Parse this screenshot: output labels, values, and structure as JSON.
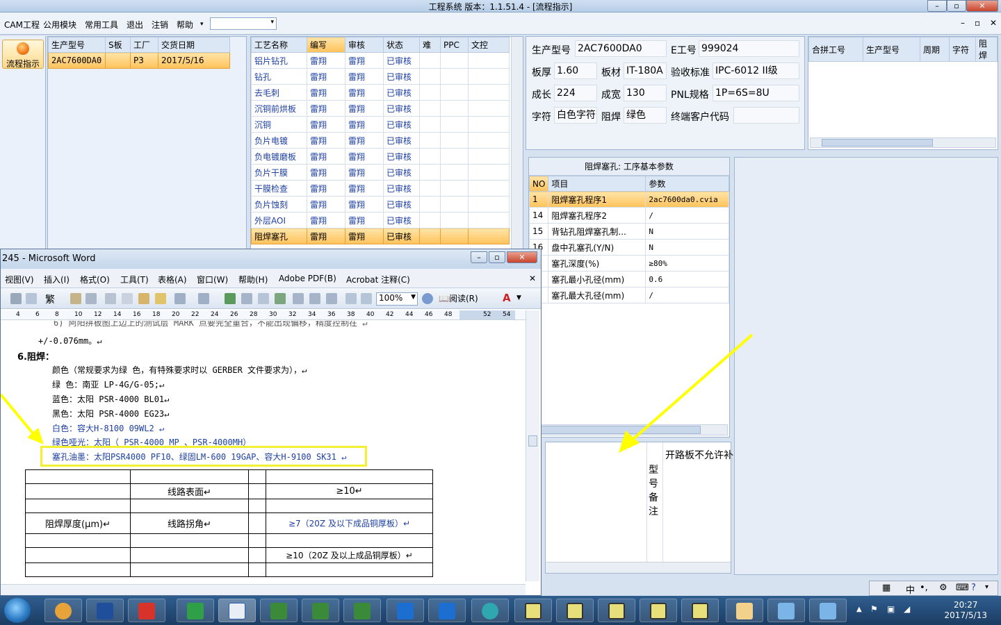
{
  "window": {
    "title": "工程系统 版本：1.1.51.4 - [流程指示]"
  },
  "menu": {
    "items": [
      "CAM工程",
      "公用模块",
      "常用工具",
      "退出",
      "注销",
      "帮助"
    ]
  },
  "nav": {
    "flow_button": "流程指示"
  },
  "orders": {
    "headers": [
      "生产型号",
      "S板",
      "工厂",
      "交货日期"
    ],
    "rows": [
      [
        "2AC7600DA0",
        "",
        "P3",
        "2017/5/16"
      ]
    ]
  },
  "process": {
    "headers": [
      "工艺名称",
      "编写",
      "审核",
      "状态",
      "难",
      "PPC",
      "文控"
    ],
    "rows": [
      [
        "铝片钻孔",
        "雷翔",
        "雷翔",
        "已审核"
      ],
      [
        "钻孔",
        "雷翔",
        "雷翔",
        "已审核"
      ],
      [
        "去毛刺",
        "雷翔",
        "雷翔",
        "已审核"
      ],
      [
        "沉铜前烘板",
        "雷翔",
        "雷翔",
        "已审核"
      ],
      [
        "沉铜",
        "雷翔",
        "雷翔",
        "已审核"
      ],
      [
        "负片电镀",
        "雷翔",
        "雷翔",
        "已审核"
      ],
      [
        "负电镀磨板",
        "雷翔",
        "雷翔",
        "已审核"
      ],
      [
        "负片干膜",
        "雷翔",
        "雷翔",
        "已审核"
      ],
      [
        "干膜检查",
        "雷翔",
        "雷翔",
        "已审核"
      ],
      [
        "负片蚀刻",
        "雷翔",
        "雷翔",
        "已审核"
      ],
      [
        "外层AOI",
        "雷翔",
        "雷翔",
        "已审核"
      ],
      [
        "阻焊塞孔",
        "雷翔",
        "雷翔",
        "已审核"
      ]
    ]
  },
  "info": {
    "model_label": "生产型号",
    "model": "2AC7600DA0",
    "eno_label": "E工号",
    "eno": "999024",
    "thick_label": "板厚",
    "thick": "1.60",
    "mat_label": "板材",
    "mat": "IT-180A",
    "std_label": "验收标准",
    "std": "IPC-6012 II级",
    "grow_label": "成长",
    "grow": "224",
    "width_label": "成宽",
    "width": "130",
    "pnl_label": "PNL规格",
    "pnl": "1P=6S=8U",
    "char_label": "字符",
    "char": "白色字符",
    "mask_label": "阻焊",
    "mask": "绿色",
    "cust_label": "终端客户代码",
    "cust": ""
  },
  "combo": {
    "headers": [
      "合拼工号",
      "生产型号",
      "周期",
      "字符",
      "阻焊"
    ]
  },
  "params": {
    "caption": "阻焊塞孔: 工序基本参数",
    "headers": [
      "NO",
      "项目",
      "参数"
    ],
    "rows": [
      [
        "1",
        "阻焊塞孔程序1",
        "2ac7600da0.cvia"
      ],
      [
        "14",
        "阻焊塞孔程序2",
        "/"
      ],
      [
        "15",
        "背钻孔阻焊塞孔制...",
        "N"
      ],
      [
        "16",
        "盘中孔塞孔(Y/N)",
        "N"
      ],
      [
        "",
        "塞孔深度(%)",
        "≥80%"
      ],
      [
        "",
        "塞孔最小孔径(mm)",
        "0.6"
      ],
      [
        "",
        "塞孔最大孔径(mm)",
        "/"
      ]
    ]
  },
  "remark": {
    "side_label": "型号备注",
    "text": "开路板不允许补"
  },
  "word": {
    "title": "245 - Microsoft Word",
    "menu": [
      "视图(V)",
      "插入(I)",
      "格式(O)",
      "工具(T)",
      "表格(A)",
      "窗口(W)",
      "帮助(H)",
      "Adobe PDF(B)",
      "Acrobat 注释(C)"
    ],
    "zoom": "100%",
    "read_label": "阅读(R)",
    "ruler": [
      "4",
      "6",
      "8",
      "10",
      "12",
      "14",
      "16",
      "18",
      "20",
      "22",
      "24",
      "26",
      "28",
      "30",
      "32",
      "34",
      "36",
      "38",
      "40",
      "42",
      "44",
      "46",
      "48",
      "52",
      "54"
    ],
    "lines": [
      "+/-0.076mm。↵",
      "6.阻焊：",
      "颜色（常规要求为绿 色，有特殊要求时以 GERBER 文件要求为），↵",
      "绿 色：南亚 LP-4G/G-05;↵",
      "蓝色：太阳 PSR-4000 BL01↵",
      "黑色：太阳 PSR-4000 EG23↵",
      "白色：容大H-8100 09WL2 ↵",
      "绿色哑光：太阳（ PSR-4000 MP 、PSR-4000MH）",
      "塞孔油墨：太阳PSR4000 PF10、绿固LM-600 19GAP、容大H-9100 SK31 ↵"
    ],
    "table": {
      "surface": "线路表面↵",
      "surface_v": "≥10↵",
      "thickness": "阻焊厚度(μm)↵",
      "corner": "线路拐角↵",
      "corner_v": "≥7（20Z 及以下成品铜厚板）↵",
      "corner_v2": "≥10（20Z 及以上成品铜厚板）↵"
    }
  },
  "tray": {
    "ime": "中",
    "time": "20:27",
    "date": "2017/5/13"
  },
  "colors": {
    "selected": "#ffc25a",
    "highlight_box": "#f3f032",
    "arrow": "#ffff00",
    "link_blue": "#1c3fa3"
  }
}
